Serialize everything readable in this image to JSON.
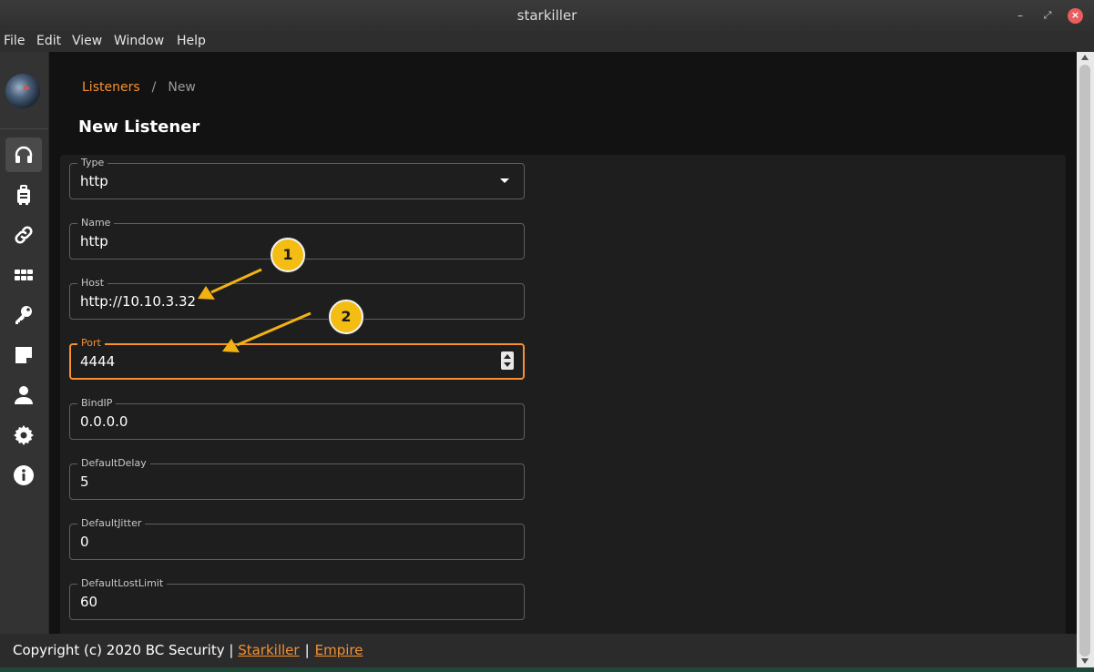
{
  "window": {
    "title": "starkiller",
    "min_glyph": "–",
    "max_glyph": "⤢",
    "close_glyph": "×"
  },
  "menu": [
    "File",
    "Edit",
    "View",
    "Window",
    "Help"
  ],
  "sidebar": {
    "items": [
      {
        "name": "listeners",
        "icon": "headphones-icon",
        "active": true
      },
      {
        "name": "stagers",
        "icon": "luggage-icon"
      },
      {
        "name": "agents",
        "icon": "link-icon"
      },
      {
        "name": "modules",
        "icon": "grid-icon"
      },
      {
        "name": "credentials",
        "icon": "key-icon"
      },
      {
        "name": "reporting",
        "icon": "note-icon"
      },
      {
        "name": "users",
        "icon": "user-icon"
      },
      {
        "name": "settings",
        "icon": "gear-icon"
      },
      {
        "name": "about",
        "icon": "info-icon"
      }
    ]
  },
  "breadcrumb": {
    "parent": "Listeners",
    "separator": "/",
    "current": "New"
  },
  "page_title": "New Listener",
  "form": {
    "type": {
      "label": "Type",
      "value": "http"
    },
    "name": {
      "label": "Name",
      "value": "http"
    },
    "host": {
      "label": "Host",
      "value": "http://10.10.3.32"
    },
    "port": {
      "label": "Port",
      "value": "4444"
    },
    "bindip": {
      "label": "BindIP",
      "value": "0.0.0.0"
    },
    "default_delay": {
      "label": "DefaultDelay",
      "value": "5"
    },
    "default_jitter": {
      "label": "DefaultJitter",
      "value": "0"
    },
    "default_lost_limit": {
      "label": "DefaultLostLimit",
      "value": "60"
    }
  },
  "annotations": {
    "badge1": "1",
    "badge2": "2"
  },
  "footer": {
    "copyright": "Copyright (c) 2020 BC Security |",
    "link1": "Starkiller",
    "sep": "|",
    "link2": "Empire"
  },
  "colors": {
    "accent": "#f7902f",
    "badge": "#f3bd14",
    "arrow": "#f3b214",
    "close": "#e95d5d"
  }
}
